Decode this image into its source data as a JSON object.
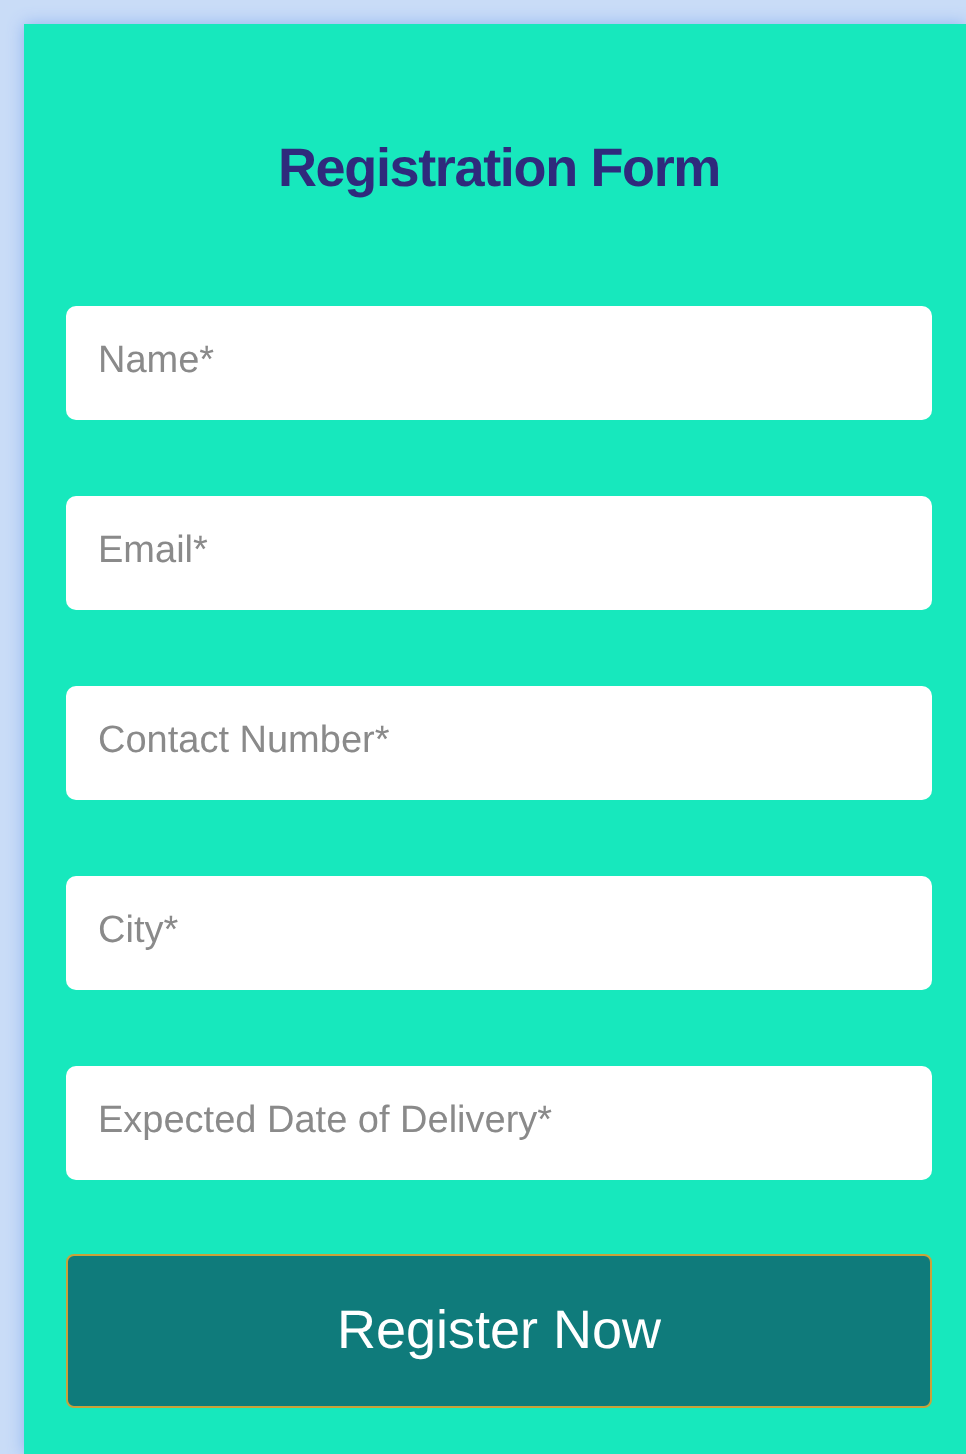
{
  "form": {
    "title": "Registration Form",
    "fields": [
      {
        "placeholder": "Name*"
      },
      {
        "placeholder": "Email*"
      },
      {
        "placeholder": "Contact Number*"
      },
      {
        "placeholder": "City*"
      },
      {
        "placeholder": "Expected Date of Delivery*"
      }
    ],
    "submit": "Register Now"
  }
}
